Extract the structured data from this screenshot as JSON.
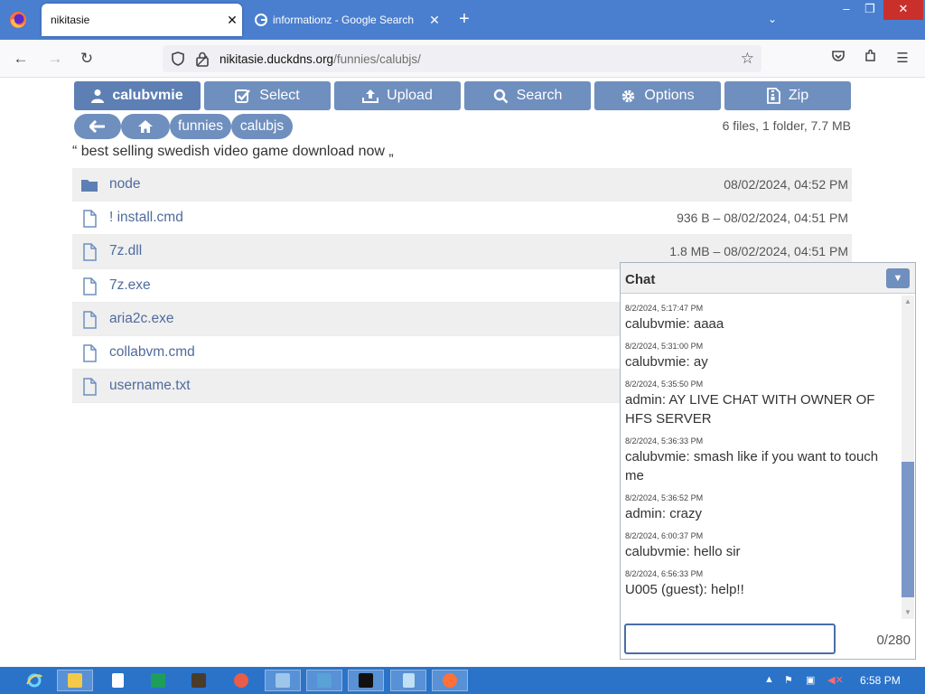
{
  "browser": {
    "tabs": [
      {
        "title": "nikitasie",
        "active": true
      },
      {
        "title": "informationz - Google Search",
        "active": false
      }
    ],
    "url_host": "nikitasie.duckdns.org",
    "url_path": "/funnies/calubjs/"
  },
  "toolbar": {
    "user_label": "calubvmie",
    "select_label": "Select",
    "upload_label": "Upload",
    "search_label": "Search",
    "options_label": "Options",
    "zip_label": "Zip"
  },
  "breadcrumb": {
    "items": [
      "funnies",
      "calubjs"
    ]
  },
  "summary": "6 files, 1 folder, 7.7 MB",
  "comment": "“ best selling swedish video game download now „",
  "files": [
    {
      "name": "node",
      "info": "08/02/2024, 04:52 PM",
      "type": "folder"
    },
    {
      "name": "! install.cmd",
      "info": "936 B – 08/02/2024, 04:51 PM",
      "type": "file"
    },
    {
      "name": "7z.dll",
      "info": "1.8 MB – 08/02/2024, 04:51 PM",
      "type": "file"
    },
    {
      "name": "7z.exe",
      "info": "",
      "type": "file"
    },
    {
      "name": "aria2c.exe",
      "info": "",
      "type": "file"
    },
    {
      "name": "collabvm.cmd",
      "info": "",
      "type": "file"
    },
    {
      "name": "username.txt",
      "info": "",
      "type": "file"
    }
  ],
  "chat": {
    "title": "Chat",
    "messages": [
      {
        "time": "8/2/2024, 5:17:47 PM",
        "text": "calubvmie: aaaa"
      },
      {
        "time": "8/2/2024, 5:31:00 PM",
        "text": "calubvmie: ay"
      },
      {
        "time": "8/2/2024, 5:35:50 PM",
        "text": "admin: AY LIVE CHAT WITH OWNER OF HFS SERVER"
      },
      {
        "time": "8/2/2024, 5:36:33 PM",
        "text": "calubvmie: smash like if you want to touch me"
      },
      {
        "time": "8/2/2024, 5:36:52 PM",
        "text": "admin: crazy"
      },
      {
        "time": "8/2/2024, 6:00:37 PM",
        "text": "calubvmie: hello sir"
      },
      {
        "time": "8/2/2024, 6:56:33 PM",
        "text": "U005 (guest): help!!"
      }
    ],
    "input_value": "",
    "counter": "0/280"
  },
  "taskbar": {
    "clock": "6:58 PM"
  },
  "colors": {
    "accent": "#6f8fbe",
    "tabstrip": "#4a7fcf",
    "taskbar": "#2a73c9"
  }
}
